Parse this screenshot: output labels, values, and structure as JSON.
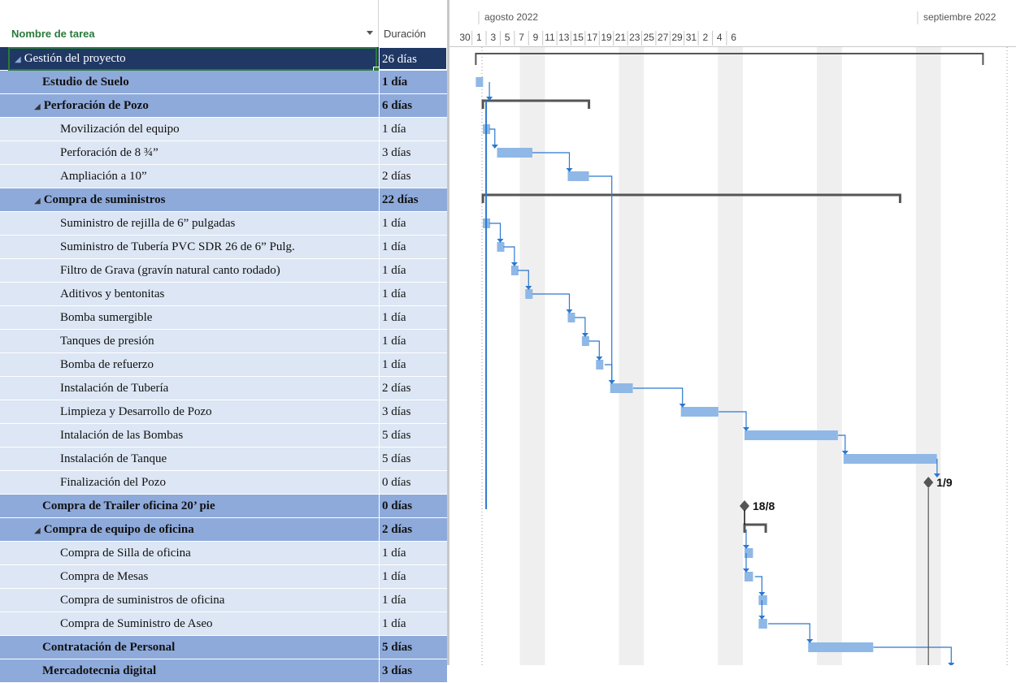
{
  "table": {
    "header": {
      "name": "Nombre de tarea",
      "duration": "Duración"
    },
    "rows": [
      {
        "name": "Gestión del proyecto",
        "duration": "26 días",
        "level": "top",
        "collapse": true
      },
      {
        "name": "Estudio de Suelo",
        "duration": "1 día",
        "level": 0,
        "collapse": false
      },
      {
        "name": "Perforación de Pozo",
        "duration": "6 días",
        "level": 0,
        "collapse": true
      },
      {
        "name": "Movilización del equipo",
        "duration": "1 día",
        "level": 1
      },
      {
        "name": "Perforación de 8 ¾”",
        "duration": "3 días",
        "level": 1
      },
      {
        "name": "Ampliación a 10”",
        "duration": "2 días",
        "level": 1
      },
      {
        "name": "Compra de suministros",
        "duration": "22 días",
        "level": 0,
        "collapse": true
      },
      {
        "name": "Suministro de rejilla de 6” pulgadas",
        "duration": "1 día",
        "level": 1
      },
      {
        "name": "Suministro de Tubería PVC SDR 26 de 6” Pulg.",
        "duration": "1 día",
        "level": 1
      },
      {
        "name": "Filtro de Grava (gravín natural canto rodado)",
        "duration": "1 día",
        "level": 1
      },
      {
        "name": "Aditivos y bentonitas",
        "duration": "1 día",
        "level": 1
      },
      {
        "name": "Bomba sumergible",
        "duration": "1 día",
        "level": 1
      },
      {
        "name": "Tanques de presión",
        "duration": "1 día",
        "level": 1
      },
      {
        "name": "Bomba de refuerzo",
        "duration": "1 día",
        "level": 1
      },
      {
        "name": "Instalación de Tubería",
        "duration": "2 días",
        "level": 1
      },
      {
        "name": "Limpieza y Desarrollo de Pozo",
        "duration": "3 días",
        "level": 1
      },
      {
        "name": "Intalación de las Bombas",
        "duration": "5 días",
        "level": 1
      },
      {
        "name": "Instalación de Tanque",
        "duration": "5 días",
        "level": 1
      },
      {
        "name": "Finalización del Pozo",
        "duration": "0 días",
        "level": 1
      },
      {
        "name": "Compra de Trailer oficina 20’ pie",
        "duration": "0 días",
        "level": 0,
        "collapse": false
      },
      {
        "name": "Compra de equipo de oficina",
        "duration": "2 días",
        "level": 0,
        "collapse": true
      },
      {
        "name": "Compra de Silla de oficina",
        "duration": "1 día",
        "level": 1
      },
      {
        "name": "Compra de Mesas",
        "duration": "1 día",
        "level": 1
      },
      {
        "name": "Compra de suministros de oficina",
        "duration": "1 día",
        "level": 1
      },
      {
        "name": "Compra de Suministro de Aseo",
        "duration": "1 día",
        "level": 1
      },
      {
        "name": "Contratación de Personal",
        "duration": "5 días",
        "level": 0,
        "collapse": false
      },
      {
        "name": "Mercadotecnia digital",
        "duration": "3 días",
        "level": 0,
        "collapse": false
      }
    ]
  },
  "timeline": {
    "months": [
      "agosto 2022",
      "septiembre 2022"
    ],
    "days": [
      "30",
      "1",
      "3",
      "5",
      "7",
      "9",
      "11",
      "13",
      "15",
      "17",
      "19",
      "21",
      "23",
      "25",
      "27",
      "29",
      "31",
      "2",
      "4",
      "6"
    ]
  },
  "milestones": {
    "finalizacion_label": "1/9",
    "trailer_label": "18/8"
  },
  "colors": {
    "bar": "#8fb8e6",
    "link": "#2b78d0",
    "summary": "#555555",
    "header_row": "#1f3864",
    "summary_row": "#8eaadb",
    "task_row": "#dce6f4",
    "weekend": "#efefef",
    "header_text": "#2a7a3b"
  }
}
